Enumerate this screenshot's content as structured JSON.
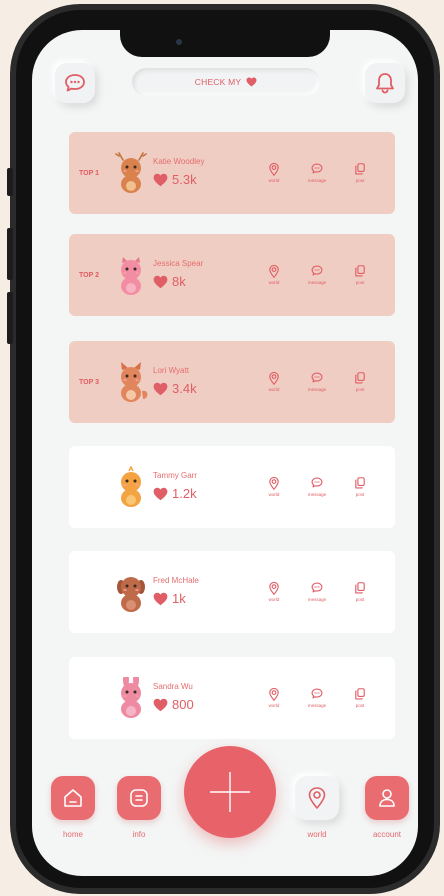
{
  "header": {
    "check_label": "CHECK MY",
    "left_icon": "chat-icon",
    "right_icon": "bell-icon"
  },
  "ranking": [
    {
      "rank": "TOP 1",
      "name": "Katie Woodley",
      "likes": "5.3k",
      "avatar": "deer-avatar",
      "highlight": true
    },
    {
      "rank": "TOP 2",
      "name": "Jessica Spear",
      "likes": "8k",
      "avatar": "pig-avatar",
      "highlight": true
    },
    {
      "rank": "TOP 3",
      "name": "Lori Wyatt",
      "likes": "3.4k",
      "avatar": "fox-avatar",
      "highlight": true
    },
    {
      "rank": "",
      "name": "Tammy Garr",
      "likes": "1.2k",
      "avatar": "chick-avatar",
      "highlight": false
    },
    {
      "rank": "",
      "name": "Fred McHale",
      "likes": "1k",
      "avatar": "puppy-avatar",
      "highlight": false
    },
    {
      "rank": "",
      "name": "Sandra Wu",
      "likes": "800",
      "avatar": "bunny-avatar",
      "highlight": false
    }
  ],
  "actions": {
    "world": "world",
    "message": "message",
    "post": "post"
  },
  "nav": {
    "home": "home",
    "info": "info",
    "world": "world",
    "account": "account"
  },
  "colors": {
    "accent": "#e86369",
    "card_top": "#f0cdc2",
    "card_plain": "#ffffff",
    "background": "#f6eee5"
  }
}
